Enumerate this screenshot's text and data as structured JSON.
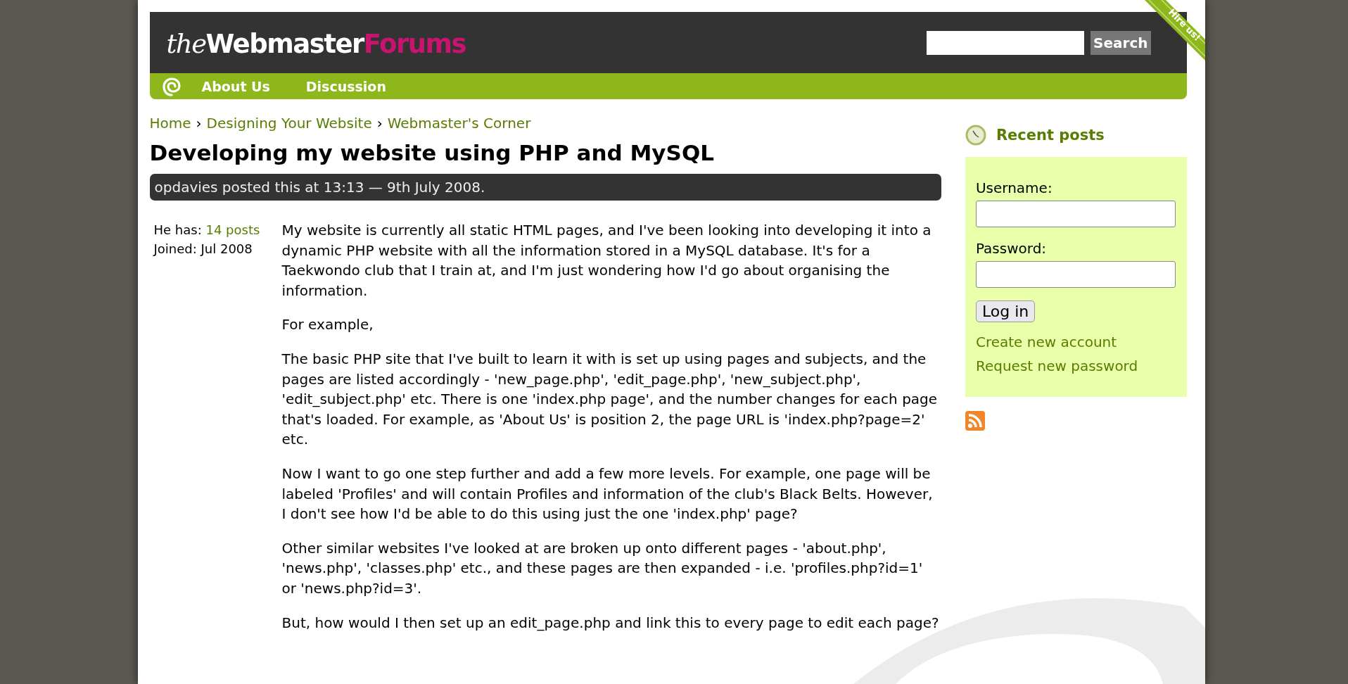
{
  "header": {
    "logo": [
      "the",
      "Webmaster",
      "Forums"
    ],
    "search": {
      "button": "Search"
    },
    "ribbon": "Hire us!"
  },
  "nav": {
    "items": [
      "About Us",
      "Discussion"
    ]
  },
  "breadcrumb": {
    "separator": "›",
    "items": [
      "Home",
      "Designing Your Website",
      "Webmaster's Corner"
    ]
  },
  "post": {
    "title": "Developing my website using PHP and MySQL",
    "meta": "opdavies posted this at 13:13 — 9th July 2008.",
    "author": {
      "has_label": "He has:",
      "posts": "14 posts",
      "joined": "Joined: Jul 2008"
    },
    "paragraphs": [
      "My website is currently all static HTML pages, and I've been looking into developing it into a dynamic PHP website with all the information stored in a MySQL database. It's for a Taekwondo club that I train at, and I'm just wondering how I'd go about organising the information.",
      "For example,",
      "The basic PHP site that I've built to learn it with is set up using pages and subjects, and the pages are listed accordingly - 'new_page.php', 'edit_page.php', 'new_subject.php', 'edit_subject.php' etc. There is one 'index.php page', and the number changes for each page that's loaded. For example, as 'About Us' is position 2, the page URL is 'index.php?page=2' etc.",
      "Now I want to go one step further and add a few more levels. For example, one page will be labeled 'Profiles' and will contain Profiles and information of the club's Black Belts. However, I don't see how I'd be able to do this using just the one 'index.php' page?",
      "Other similar websites I've looked at are broken up onto different pages - 'about.php', 'news.php', 'classes.php' etc., and these pages are then expanded - i.e. 'profiles.php?id=1' or 'news.php?id=3'.",
      "But, how would I then set up an edit_page.php and link this to every page to edit each page?"
    ]
  },
  "sidebar": {
    "heading": "Recent posts",
    "login": {
      "username_label": "Username:",
      "password_label": "Password:",
      "button": "Log in",
      "links": [
        "Create new account",
        "Request new password"
      ]
    }
  }
}
